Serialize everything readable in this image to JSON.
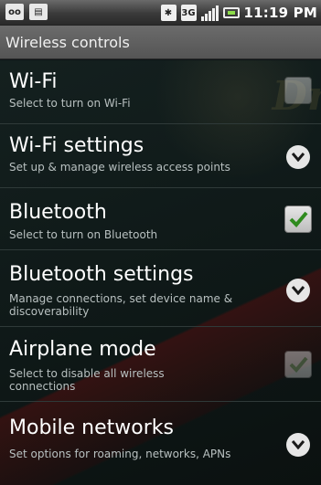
{
  "status_bar": {
    "time": "11:19 PM",
    "left_icons": [
      "voicemail-icon",
      "notification-icon"
    ],
    "right_icons": [
      "bluetooth-icon",
      "3g-icon",
      "signal-icon",
      "battery-icon"
    ],
    "voicemail_glyph": "oo",
    "notification_glyph": "▤",
    "bluetooth_glyph": "✱",
    "network_glyph": "3G"
  },
  "header": {
    "title": "Wireless controls"
  },
  "settings": [
    {
      "title": "Wi-Fi",
      "summary": "Select to turn on Wi-Fi",
      "control": "checkbox",
      "checked": false,
      "enabled": false
    },
    {
      "title": "Wi-Fi settings",
      "summary": "Set up & manage wireless access points",
      "control": "arrow"
    },
    {
      "title": "Bluetooth",
      "summary": "Select to turn on Bluetooth",
      "control": "checkbox",
      "checked": true,
      "enabled": true
    },
    {
      "title": "Bluetooth settings",
      "summary": "Manage connections, set device name & discoverability",
      "control": "arrow"
    },
    {
      "title": "Airplane mode",
      "summary": "Select to disable all wireless connections",
      "control": "checkbox",
      "checked": false,
      "enabled": false
    },
    {
      "title": "Mobile networks",
      "summary": "Set options for roaming, networks, APNs",
      "control": "arrow"
    }
  ],
  "colors": {
    "check_mark": "#2e8b1e",
    "title_text": "#ffffff",
    "summary_text": "#b8c0c0"
  }
}
